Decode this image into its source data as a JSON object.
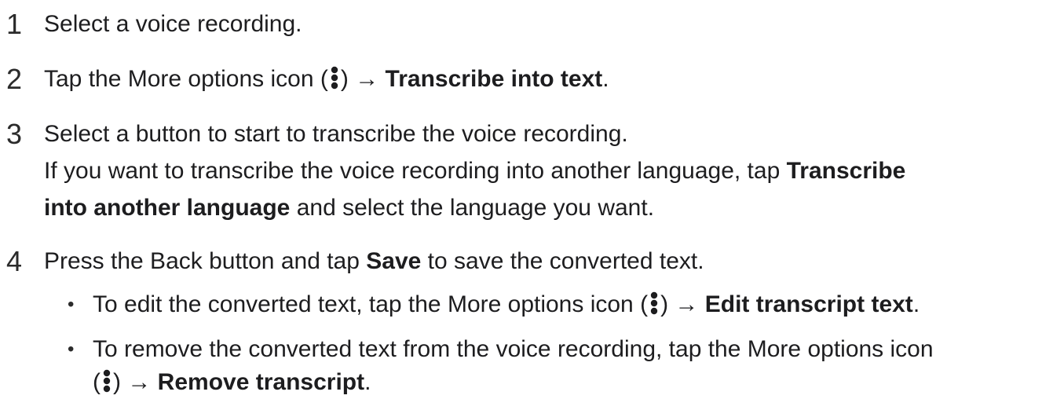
{
  "steps": [
    {
      "number": "1",
      "text": "Select a voice recording."
    },
    {
      "number": "2",
      "text_before": "Tap the More options icon (",
      "text_middle": ") → ",
      "bold": "Transcribe into text",
      "text_after": "."
    },
    {
      "number": "3",
      "line1": "Select a button to start to transcribe the voice recording.",
      "line2_before": "If you want to transcribe the voice recording into another language, tap ",
      "line2_bold": "Transcribe",
      "line3_bold": "into another language",
      "line3_after": " and select the language you want."
    },
    {
      "number": "4",
      "before": "Press the Back button and tap ",
      "bold": "Save",
      "after": " to save the converted text.",
      "bullets": [
        {
          "symbol": "•",
          "before": "To edit the converted text, tap the More options icon (",
          "middle": ") → ",
          "bold": "Edit transcript text",
          "after": "."
        },
        {
          "symbol": "•",
          "line1": "To remove the converted text from the voice recording, tap the More options icon",
          "line2_before": "(",
          "line2_middle": ") → ",
          "line2_bold": "Remove transcript",
          "line2_after": "."
        }
      ]
    }
  ],
  "icon": {
    "name": "more-options-icon",
    "color": "#1d1d1f"
  }
}
